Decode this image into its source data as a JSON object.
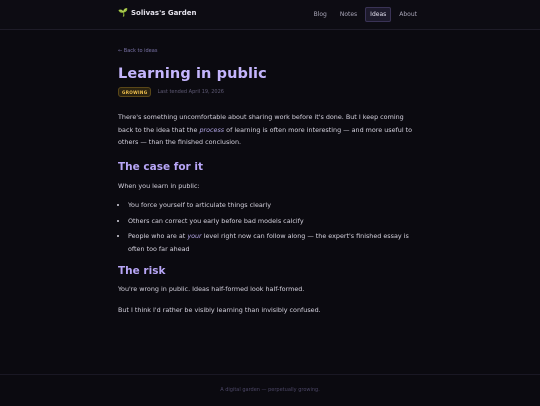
{
  "site": {
    "brand_icon": "sprout-icon",
    "brand_name": "Solivas's Garden",
    "accent_color": "#c4b5fd"
  },
  "nav": {
    "items": [
      {
        "label": "Blog",
        "active": false
      },
      {
        "label": "Notes",
        "active": false
      },
      {
        "label": "Ideas",
        "active": true
      },
      {
        "label": "About",
        "active": false
      }
    ]
  },
  "article": {
    "back_link": "← Back to ideas",
    "title": "Learning in public",
    "badge": "GROWING",
    "tended": "Last tended April 19, 2026",
    "intro_before": "There's something uncomfortable about sharing work before it's done. But I keep coming back to the idea that the ",
    "intro_em": "process",
    "intro_after": " of learning is often more interesting — and more useful to others — than the finished conclusion.",
    "section1_heading": "The case for it",
    "section1_lead": "When you learn in public:",
    "bullet1": "You force yourself to articulate things clearly",
    "bullet2": "Others can correct you early before bad models calcify",
    "bullet3_before": "People who are at ",
    "bullet3_em": "your",
    "bullet3_after": " level right now can follow along — the expert's finished essay is often too far ahead",
    "section2_heading": "The risk",
    "section2_p1": "You're wrong in public. Ideas half-formed look half-formed.",
    "section2_p2": "But I think I'd rather be visibly learning than invisibly confused."
  },
  "footer": {
    "text": "A digital garden — perpetually growing."
  }
}
